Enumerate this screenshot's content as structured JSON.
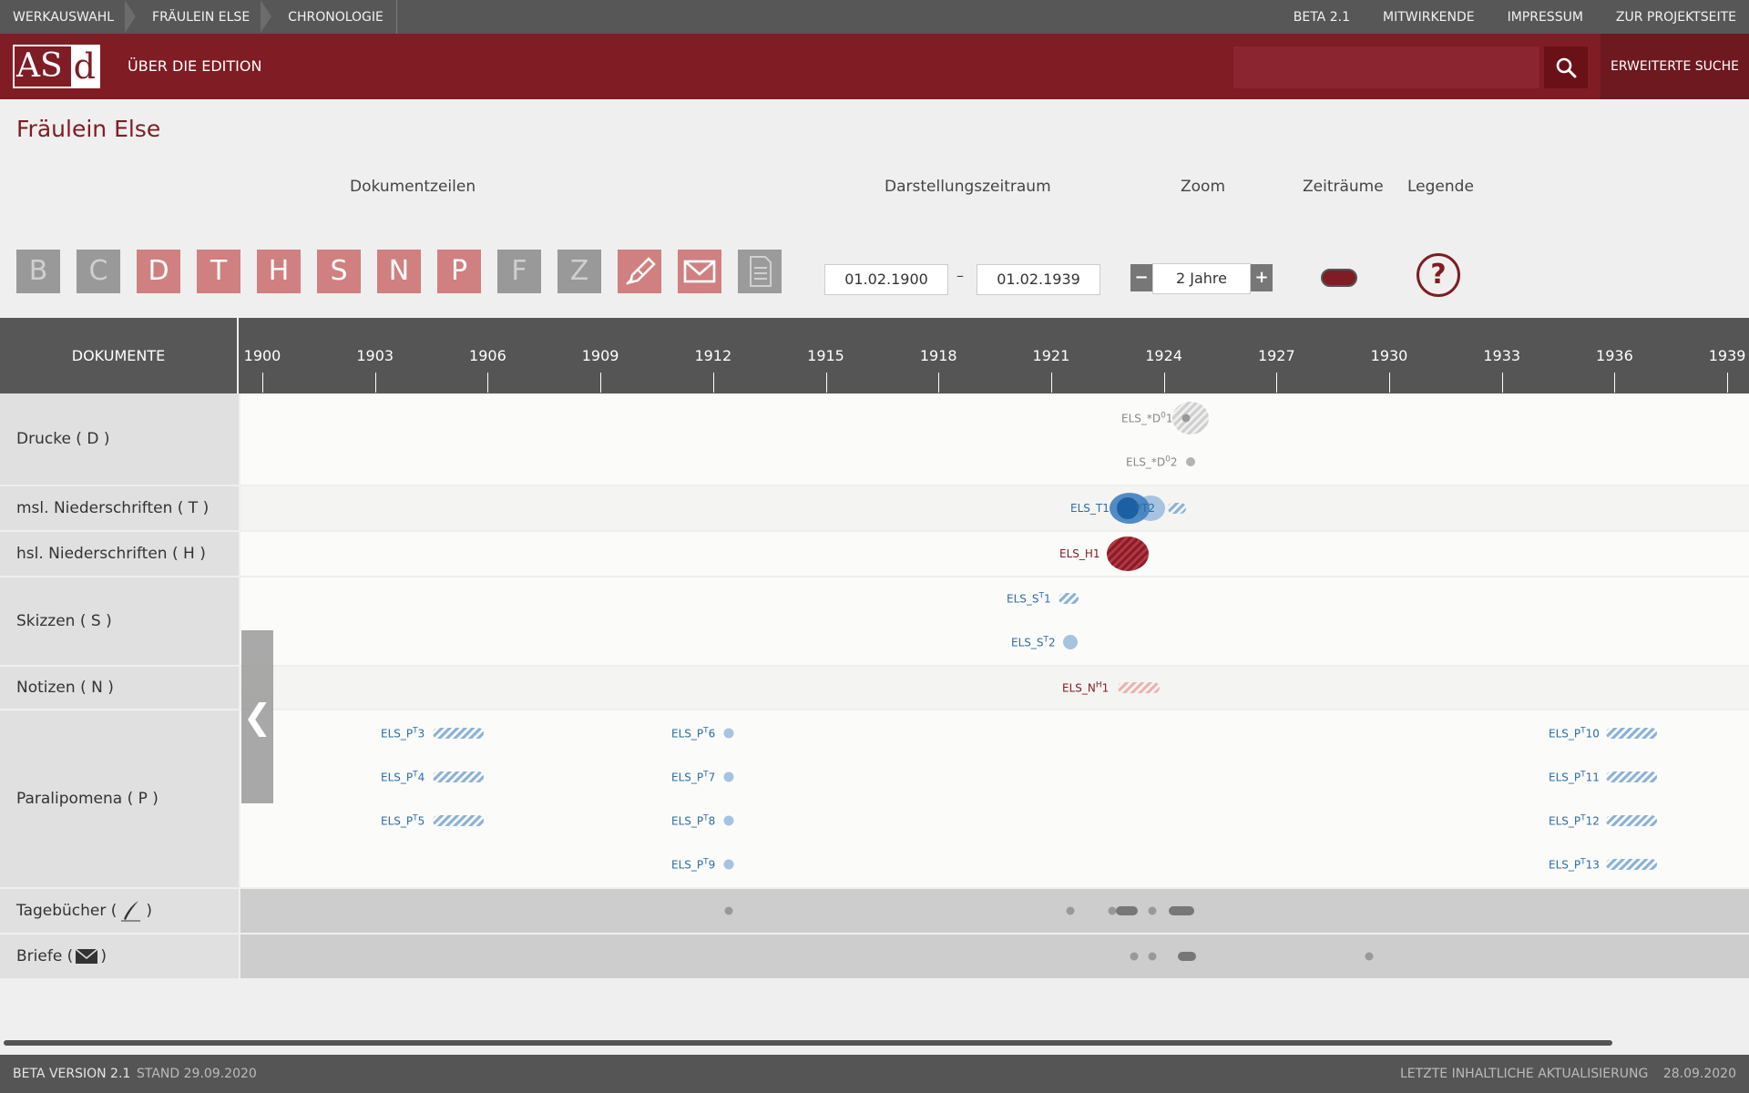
{
  "breadcrumb": [
    "WERKAUSWAHL",
    "FRÄULEIN ELSE",
    "CHRONOLOGIE"
  ],
  "toplinks": [
    "BETA 2.1",
    "MITWIRKENDE",
    "IMPRESSUM",
    "ZUR PROJEKTSEITE"
  ],
  "header": {
    "logo_a": "AS",
    "logo_d": "d",
    "about": "ÜBER DIE EDITION",
    "search_placeholder": "",
    "advanced_search": "ERWEITERTE SUCHE"
  },
  "page_title": "Fräulein Else",
  "controls": {
    "doc_rows_label": "Dokumentzeilen",
    "range_label": "Darstellungszeitraum",
    "zoom_label": "Zoom",
    "periods_label": "Zeiträume",
    "legend_label": "Legende",
    "doc_buttons": [
      {
        "letter": "B",
        "active": false
      },
      {
        "letter": "C",
        "active": false
      },
      {
        "letter": "D",
        "active": true
      },
      {
        "letter": "T",
        "active": true
      },
      {
        "letter": "H",
        "active": true
      },
      {
        "letter": "S",
        "active": true
      },
      {
        "letter": "N",
        "active": true
      },
      {
        "letter": "P",
        "active": true
      },
      {
        "letter": "F",
        "active": false
      },
      {
        "letter": "Z",
        "active": false
      }
    ],
    "icon_buttons": [
      {
        "icon": "feather-pen-icon",
        "active": true
      },
      {
        "icon": "envelope-icon",
        "active": true
      },
      {
        "icon": "document-icon",
        "active": false
      }
    ],
    "date_from": "01.02.1900",
    "date_dash": "–",
    "date_to": "01.02.1939",
    "zoom_minus": "−",
    "zoom_value": "2 Jahre",
    "zoom_plus": "+",
    "legend_symbol": "?"
  },
  "timeline": {
    "docs_header": "DOKUMENTE",
    "years": [
      "1900",
      "1903",
      "1906",
      "1909",
      "1912",
      "1915",
      "1918",
      "1921",
      "1924",
      "1927",
      "1930",
      "1933",
      "1936",
      "1939"
    ],
    "rows": [
      {
        "label": "Drucke ( D )"
      },
      {
        "label": "msl. Niederschriften ( T )"
      },
      {
        "label": "hsl. Niederschriften ( H )"
      },
      {
        "label": "Skizzen ( S )"
      },
      {
        "label": "Notizen ( N )"
      },
      {
        "label": "Paralipomena ( P )"
      },
      {
        "label_pre": "Tagebücher (",
        "label_post": " )"
      },
      {
        "label_pre": "Briefe (",
        "label_post": " )"
      }
    ],
    "documents": {
      "d1": {
        "pre": "ELS_*D",
        "sup": "0",
        "post": "1"
      },
      "d2": {
        "pre": "ELS_*D",
        "sup": "0",
        "post": "2"
      },
      "t1": {
        "pre": "ELS_T1",
        "sup": "",
        "post": ""
      },
      "t2": {
        "pre": "*T2",
        "sup": "",
        "post": ""
      },
      "h1": {
        "pre": "ELS_H1",
        "sup": "",
        "post": ""
      },
      "s1": {
        "pre": "ELS_S",
        "sup": "T",
        "post": "1"
      },
      "s2": {
        "pre": "ELS_S",
        "sup": "T",
        "post": "2"
      },
      "n1": {
        "pre": "ELS_N",
        "sup": "H",
        "post": "1"
      },
      "p3": {
        "pre": "ELS_P",
        "sup": "T",
        "post": "3"
      },
      "p4": {
        "pre": "ELS_P",
        "sup": "T",
        "post": "4"
      },
      "p5": {
        "pre": "ELS_P",
        "sup": "T",
        "post": "5"
      },
      "p6": {
        "pre": "ELS_P",
        "sup": "T",
        "post": "6"
      },
      "p7": {
        "pre": "ELS_P",
        "sup": "T",
        "post": "7"
      },
      "p8": {
        "pre": "ELS_P",
        "sup": "T",
        "post": "8"
      },
      "p9": {
        "pre": "ELS_P",
        "sup": "T",
        "post": "9"
      },
      "p10": {
        "pre": "ELS_P",
        "sup": "T",
        "post": "10"
      },
      "p11": {
        "pre": "ELS_P",
        "sup": "T",
        "post": "11"
      },
      "p12": {
        "pre": "ELS_P",
        "sup": "T",
        "post": "12"
      },
      "p13": {
        "pre": "ELS_P",
        "sup": "T",
        "post": "13"
      }
    },
    "collapse_symbol": "❮"
  },
  "footer": {
    "version": "BETA VERSION 2.1",
    "stand": "STAND 29.09.2020",
    "update_label": "LETZTE INHALTLICHE AKTUALISIERUNG",
    "update_date": "28.09.2020"
  },
  "colors": {
    "brand": "#7f1c24",
    "active_button": "#d08080",
    "inactive_button": "#999999",
    "blue": "#2e6da4"
  }
}
